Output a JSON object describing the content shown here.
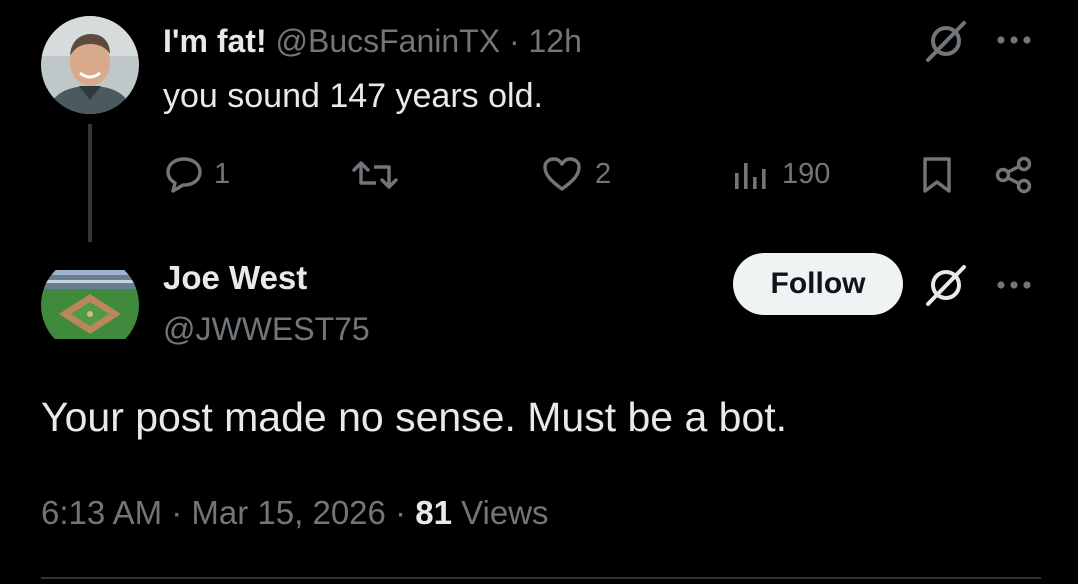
{
  "reply": {
    "display_name": "I'm fat!",
    "handle": "@BucsFaninTX",
    "separator": "·",
    "time": "12h",
    "text": "you sound 147 years old.",
    "avatar_icon": "person-avatar",
    "actions": {
      "reply_count": "1",
      "retweet_count": "",
      "like_count": "2",
      "views_count": "190"
    }
  },
  "main": {
    "display_name": "Joe West",
    "handle": "@JWWEST75",
    "avatar_icon": "baseball-stadium-avatar",
    "follow_label": "Follow",
    "text": "Your post made no sense. Must be a bot.",
    "meta": {
      "time": "6:13 AM",
      "dot1": "·",
      "date": "Mar 15, 2026",
      "dot2": "·",
      "views_count": "81",
      "views_label": "Views"
    }
  },
  "colors": {
    "background": "#000000",
    "text": "#e7e9ea",
    "muted": "#71767b",
    "follow_bg": "#eff3f4",
    "follow_text": "#0f1419"
  }
}
